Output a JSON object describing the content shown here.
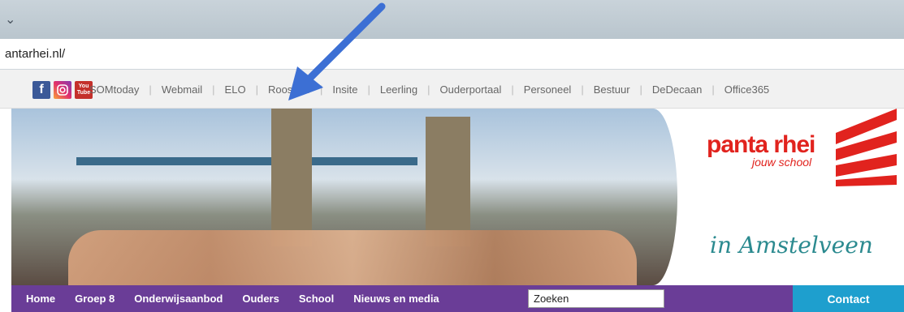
{
  "address": {
    "url": "antarhei.nl/"
  },
  "social": {
    "fb": "f",
    "yt_top": "You",
    "yt_bottom": "Tube"
  },
  "toplinks": [
    "SOMtoday",
    "Webmail",
    "ELO",
    "Roosters",
    "Insite",
    "Leerling",
    "Ouderportaal",
    "Personeel",
    "Bestuur",
    "DeDecaan",
    "Office365"
  ],
  "logo": {
    "name": "panta rhei",
    "tagline": "jouw school"
  },
  "location": "in Amstelveen",
  "mainnav": {
    "items": [
      "Home",
      "Groep 8",
      "Onderwijsaanbod",
      "Ouders",
      "School",
      "Nieuws en media"
    ],
    "search_value": "Zoeken",
    "contact": "Contact"
  },
  "colors": {
    "purple": "#6a3d97",
    "contact_blue": "#1e9fce",
    "brand_red": "#e1231e",
    "arrow": "#3c6fd4"
  }
}
